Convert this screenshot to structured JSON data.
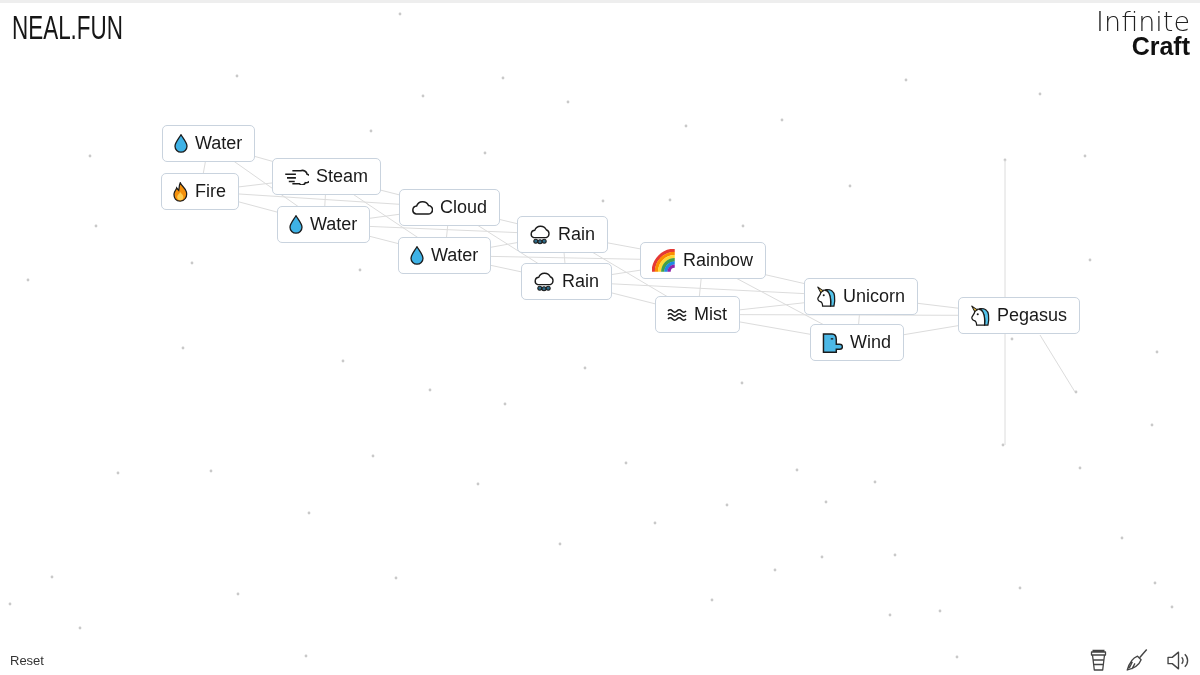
{
  "header": {
    "logo": "NEAL.FUN",
    "title_lines": [
      "Infinite",
      "Craft"
    ]
  },
  "canvas": {
    "elements": [
      {
        "kind": "water",
        "label": "Water"
      },
      {
        "kind": "fire",
        "label": "Fire"
      },
      {
        "kind": "steam",
        "label": "Steam"
      },
      {
        "kind": "water",
        "label": "Water"
      },
      {
        "kind": "cloud",
        "label": "Cloud"
      },
      {
        "kind": "water",
        "label": "Water"
      },
      {
        "kind": "rain",
        "label": "Rain"
      },
      {
        "kind": "rain",
        "label": "Rain"
      },
      {
        "kind": "rainbow",
        "label": "Rainbow"
      },
      {
        "kind": "mist",
        "label": "Mist"
      },
      {
        "kind": "unicorn",
        "label": "Unicorn"
      },
      {
        "kind": "wind",
        "label": "Wind"
      },
      {
        "kind": "unicorn",
        "label": "Pegasus"
      }
    ]
  },
  "footer": {
    "reset_button": "Reset"
  }
}
